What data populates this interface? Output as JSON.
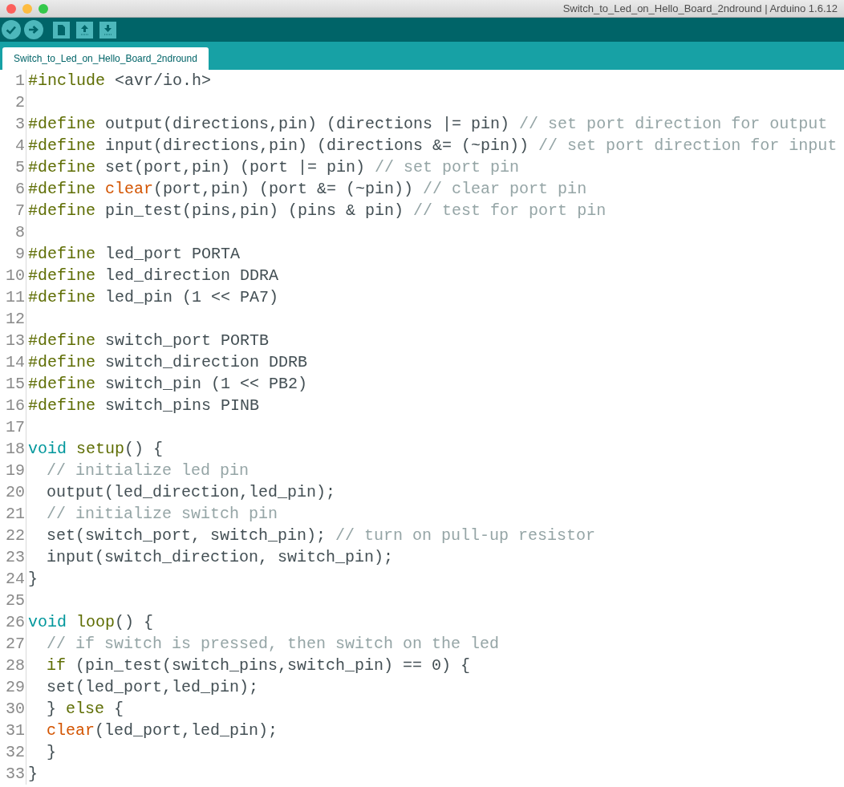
{
  "window": {
    "title": "Switch_to_Led_on_Hello_Board_2ndround | Arduino 1.6.12"
  },
  "tabs": [
    {
      "label": "Switch_to_Led_on_Hello_Board_2ndround",
      "selected": true
    }
  ],
  "editor": {
    "lines": [
      {
        "number": "1",
        "indent": false,
        "tokens": [
          {
            "kind": "preproc",
            "text": "#include"
          },
          {
            "kind": "plain",
            "text": " <avr/io.h>"
          }
        ]
      },
      {
        "number": "2"
      },
      {
        "number": "3",
        "indent": false,
        "tokens": [
          {
            "kind": "preproc",
            "text": "#define"
          },
          {
            "kind": "plain",
            "text": " output(directions,pin) (directions |= pin) "
          },
          {
            "kind": "comment",
            "text": "// set port direction for output"
          }
        ]
      },
      {
        "number": "4",
        "indent": false,
        "tokens": [
          {
            "kind": "preproc",
            "text": "#define"
          },
          {
            "kind": "plain",
            "text": " input(directions,pin) (directions &= (~pin)) "
          },
          {
            "kind": "comment",
            "text": "// set port direction for input"
          }
        ]
      },
      {
        "number": "5",
        "indent": false,
        "tokens": [
          {
            "kind": "preproc",
            "text": "#define"
          },
          {
            "kind": "plain",
            "text": " set(port,pin) (port |= pin) "
          },
          {
            "kind": "comment",
            "text": "// set port pin"
          }
        ]
      },
      {
        "number": "6",
        "indent": false,
        "tokens": [
          {
            "kind": "preproc",
            "text": "#define "
          },
          {
            "kind": "builtin",
            "text": "clear"
          },
          {
            "kind": "plain",
            "text": "(port,pin) (port &= (~pin)) "
          },
          {
            "kind": "comment",
            "text": "// clear port pin"
          }
        ]
      },
      {
        "number": "7",
        "indent": false,
        "tokens": [
          {
            "kind": "preproc",
            "text": "#define"
          },
          {
            "kind": "plain",
            "text": " pin_test(pins,pin) (pins & pin) "
          },
          {
            "kind": "comment",
            "text": "// test for port pin"
          }
        ]
      },
      {
        "number": "8"
      },
      {
        "number": "9",
        "indent": false,
        "tokens": [
          {
            "kind": "preproc",
            "text": "#define"
          },
          {
            "kind": "plain",
            "text": " led_port PORTA"
          }
        ]
      },
      {
        "number": "10",
        "indent": false,
        "tokens": [
          {
            "kind": "preproc",
            "text": "#define"
          },
          {
            "kind": "plain",
            "text": " led_direction DDRA"
          }
        ]
      },
      {
        "number": "11",
        "indent": false,
        "tokens": [
          {
            "kind": "preproc",
            "text": "#define"
          },
          {
            "kind": "plain",
            "text": " led_pin (1 << PA7)"
          }
        ]
      },
      {
        "number": "12"
      },
      {
        "number": "13",
        "indent": false,
        "tokens": [
          {
            "kind": "preproc",
            "text": "#define"
          },
          {
            "kind": "plain",
            "text": " switch_port PORTB"
          }
        ]
      },
      {
        "number": "14",
        "indent": false,
        "tokens": [
          {
            "kind": "preproc",
            "text": "#define"
          },
          {
            "kind": "plain",
            "text": " switch_direction DDRB"
          }
        ]
      },
      {
        "number": "15",
        "indent": false,
        "tokens": [
          {
            "kind": "preproc",
            "text": "#define"
          },
          {
            "kind": "plain",
            "text": " switch_pin (1 << PB2)"
          }
        ]
      },
      {
        "number": "16",
        "indent": false,
        "tokens": [
          {
            "kind": "preproc",
            "text": "#define"
          },
          {
            "kind": "plain",
            "text": " switch_pins PINB"
          }
        ]
      },
      {
        "number": "17"
      },
      {
        "number": "18",
        "indent": false,
        "tokens": [
          {
            "kind": "type",
            "text": "void "
          },
          {
            "kind": "function",
            "text": "setup"
          },
          {
            "kind": "plain",
            "text": "() {"
          }
        ]
      },
      {
        "number": "19",
        "indent": true,
        "tokens": [
          {
            "kind": "comment",
            "text": "// initialize led pin"
          }
        ]
      },
      {
        "number": "20",
        "indent": true,
        "tokens": [
          {
            "kind": "plain",
            "text": "output(led_direction,led_pin);"
          }
        ]
      },
      {
        "number": "21",
        "indent": true,
        "tokens": [
          {
            "kind": "comment",
            "text": "// initialize switch pin"
          }
        ]
      },
      {
        "number": "22",
        "indent": true,
        "tokens": [
          {
            "kind": "plain",
            "text": "set(switch_port, switch_pin); "
          },
          {
            "kind": "comment",
            "text": "// turn on pull-up resistor"
          }
        ]
      },
      {
        "number": "23",
        "indent": true,
        "tokens": [
          {
            "kind": "plain",
            "text": "input(switch_direction, switch_pin);"
          }
        ]
      },
      {
        "number": "24",
        "indent": false,
        "tokens": [
          {
            "kind": "plain",
            "text": "}"
          }
        ]
      },
      {
        "number": "25"
      },
      {
        "number": "26",
        "indent": false,
        "tokens": [
          {
            "kind": "type",
            "text": "void "
          },
          {
            "kind": "function",
            "text": "loop"
          },
          {
            "kind": "plain",
            "text": "() {"
          }
        ]
      },
      {
        "number": "27",
        "indent": true,
        "tokens": [
          {
            "kind": "comment",
            "text": "// if switch is pressed, then switch on the led"
          }
        ]
      },
      {
        "number": "28",
        "indent": true,
        "tokens": [
          {
            "kind": "keyword",
            "text": "if"
          },
          {
            "kind": "plain",
            "text": " (pin_test(switch_pins,switch_pin) == 0) {"
          }
        ]
      },
      {
        "number": "29",
        "indent": true,
        "tokens": [
          {
            "kind": "plain",
            "text": "set(led_port,led_pin);"
          }
        ]
      },
      {
        "number": "30",
        "indent": true,
        "tokens": [
          {
            "kind": "plain",
            "text": "} "
          },
          {
            "kind": "keyword",
            "text": "else"
          },
          {
            "kind": "plain",
            "text": " {"
          }
        ]
      },
      {
        "number": "31",
        "indent": true,
        "tokens": [
          {
            "kind": "builtin",
            "text": "clear"
          },
          {
            "kind": "plain",
            "text": "(led_port,led_pin);"
          }
        ]
      },
      {
        "number": "32",
        "indent": true,
        "tokens": [
          {
            "kind": "plain",
            "text": "}"
          }
        ]
      },
      {
        "number": "33",
        "indent": false,
        "tokens": [
          {
            "kind": "plain",
            "text": "}"
          }
        ]
      }
    ]
  }
}
